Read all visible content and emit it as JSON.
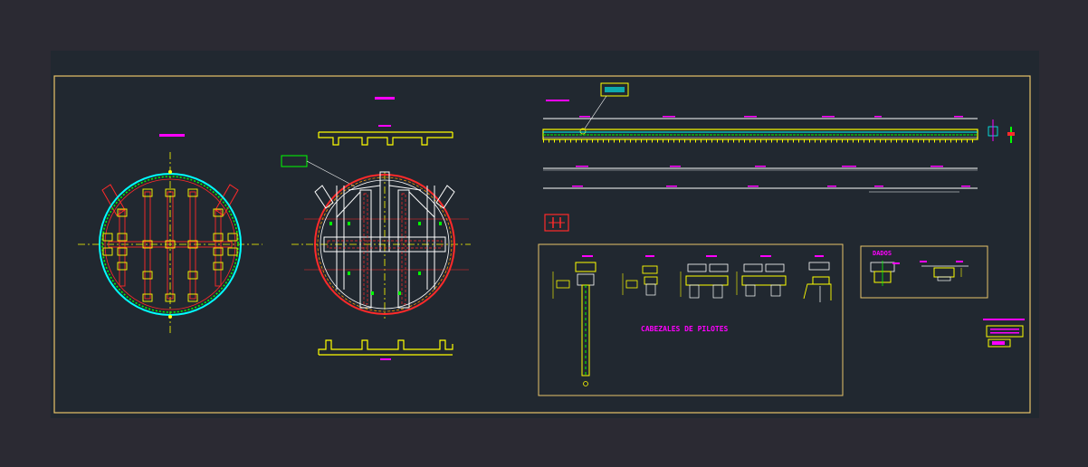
{
  "colors": {
    "app_background": "#2b2a33",
    "viewport_background": "#212830",
    "border": "#e8c36a",
    "yellow": "#ffff00",
    "red": "#ff2a2a",
    "cyan": "#00ffff",
    "green": "#00ff00",
    "magenta": "#ff00ff",
    "white": "#ffffff",
    "orange": "#ff9900",
    "dark_red": "#a83232"
  },
  "annotations": {
    "pile_caps_title": "CABEZALES DE PILOTES",
    "details_title": "DADOS"
  },
  "icons": {
    "viewport": "cad-viewport",
    "plan_left": "circular-foundation-plan-icon",
    "plan_center": "circular-beam-plan-icon",
    "elevation": "longitudinal-section-icon",
    "title_block": "title-block-icon"
  }
}
